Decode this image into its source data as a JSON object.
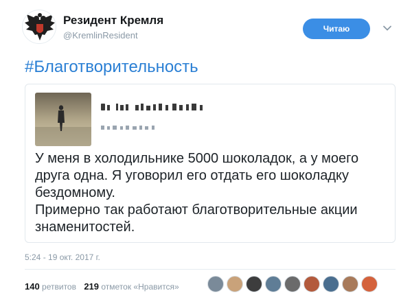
{
  "author": {
    "name": "Резидент Кремля",
    "handle": "@KremlinResident",
    "avatar_icon": "double-headed-eagle-icon"
  },
  "follow_button": {
    "label": "Читаю"
  },
  "tweet": {
    "hashtag": "#Благотворительность",
    "timestamp": "5:24 - 19 окт. 2017 г."
  },
  "quoted": {
    "lines": [
      "У меня в холодильнике 5000 шоколадок, а у моего",
      "друга одна. Я уговорил его отдать его шоколадку",
      "бездомному.",
      "Примерно так работают благотворительные акции",
      "знаменитостей."
    ]
  },
  "stats": {
    "retweets_count": "140",
    "retweets_label": "ретвитов",
    "likes_count": "219",
    "likes_label": "отметок «Нравится»"
  },
  "liker_colors": [
    "#7a8a99",
    "#c9a27a",
    "#3d3d3d",
    "#5f7d96",
    "#6b6b6b",
    "#b35a3c",
    "#4a6e8f",
    "#a87a5a",
    "#d4623c"
  ],
  "colors": {
    "accent": "#2a7fd4",
    "button": "#3b8ee5",
    "muted": "#8a99a6"
  }
}
